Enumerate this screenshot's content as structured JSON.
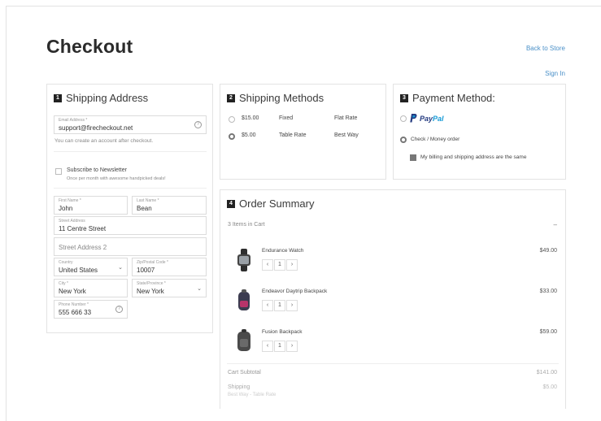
{
  "page": {
    "title": "Checkout",
    "back_link": "Back to Store",
    "sign_in": "Sign In"
  },
  "shipping_address": {
    "step": "1",
    "heading": "Shipping Address",
    "email": {
      "label": "Email Address *",
      "value": "support@firecheckout.net"
    },
    "email_note": "You can create an account after checkout.",
    "newsletter": {
      "label": "Subscribe to Newsletter",
      "note": "Once per month with awesome handpicked deals!"
    },
    "first_name": {
      "label": "First Name *",
      "value": "John"
    },
    "last_name": {
      "label": "Last Name *",
      "value": "Bean"
    },
    "street1": {
      "label": "Street Address",
      "value": "11 Centre Street"
    },
    "street2": {
      "placeholder": "Street Address 2"
    },
    "country": {
      "label": "Country",
      "value": "United States"
    },
    "postcode": {
      "label": "Zip/Postal Code *",
      "value": "10007"
    },
    "city": {
      "label": "City *",
      "value": "New York"
    },
    "state": {
      "label": "State/Province *",
      "value": "New York"
    },
    "phone": {
      "label": "Phone Number *",
      "value": "555 666 33"
    }
  },
  "shipping_methods": {
    "step": "2",
    "heading": "Shipping Methods",
    "options": [
      {
        "price": "$15.00",
        "method": "Fixed",
        "carrier": "Flat Rate",
        "selected": false
      },
      {
        "price": "$5.00",
        "method": "Table Rate",
        "carrier": "Best Way",
        "selected": true
      }
    ]
  },
  "payment": {
    "step": "3",
    "heading": "Payment Method:",
    "paypal": {
      "logo_a": "Pay",
      "logo_b": "Pal",
      "color_a": "#253b80",
      "color_b": "#179bd7"
    },
    "check_label": "Check / Money order",
    "billing_same": "My billing and shipping address are the same"
  },
  "order_summary": {
    "step": "4",
    "heading": "Order Summary",
    "count_text": "3 Items in Cart",
    "collapse": "–",
    "items": [
      {
        "name": "Endurance Watch",
        "qty": "1",
        "price": "$49.00",
        "icon": "watch-image"
      },
      {
        "name": "Endeavor Daytrip Backpack",
        "qty": "1",
        "price": "$33.00",
        "icon": "backpack-image"
      },
      {
        "name": "Fusion Backpack",
        "qty": "1",
        "price": "$59.00",
        "icon": "backpack-image"
      }
    ],
    "subtotal_label": "Cart Subtotal",
    "subtotal_value": "$141.00",
    "shipping_label": "Shipping",
    "shipping_sub": "Best Way - Table Rate",
    "shipping_value": "$5.00"
  }
}
